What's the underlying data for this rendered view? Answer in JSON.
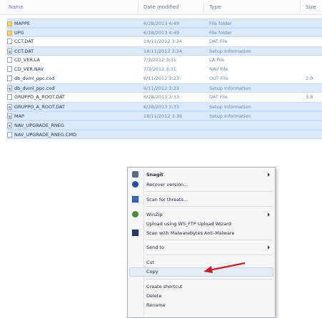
{
  "columns": {
    "name": "Name",
    "date": "Date modified",
    "type": "Type",
    "size": "Size"
  },
  "files": [
    {
      "name": "MAPPE",
      "date": "6/28/2013 4:49",
      "type": "File folder",
      "size": "",
      "icon": "folder-icon",
      "selected": true
    },
    {
      "name": "UPG",
      "date": "6/28/2013 4:49",
      "type": "File folder",
      "size": "",
      "icon": "folder-icon",
      "selected": true
    },
    {
      "name": "CCT.DAT",
      "date": "18/11/2012 3:24",
      "type": "DAT File",
      "size": "",
      "icon": "document-icon",
      "selected": false
    },
    {
      "name": "CCT.DAT",
      "date": "18/11/2012 3:24",
      "type": "Setup Information",
      "size": "",
      "icon": "setup-file-icon",
      "selected": true
    },
    {
      "name": "CD_VER.LA",
      "date": "7/3/2012 3:31",
      "type": "LA File",
      "size": "",
      "icon": "document-icon",
      "selected": false
    },
    {
      "name": "CD_VER.NAV",
      "date": "7/3/2012 3:31",
      "type": "NAV File",
      "size": "",
      "icon": "document-icon",
      "selected": false
    },
    {
      "name": "db_dvml_ppc.cod",
      "date": "6/11/2012 3:23",
      "type": "OUT File",
      "size": "2,0",
      "icon": "document-icon",
      "selected": false
    },
    {
      "name": "db_dvml_ppc.cod",
      "date": "6/11/2012 3:23",
      "type": "Setup Information",
      "size": "",
      "icon": "setup-file-icon",
      "selected": true
    },
    {
      "name": "GRUPPO_A_ROOT.DAT",
      "date": "6/28/2013 3:33",
      "type": "DAT File",
      "size": "3,8",
      "icon": "document-icon",
      "selected": false
    },
    {
      "name": "GRUPPO_A_ROOT.DAT",
      "date": "6/28/2013 3:33",
      "type": "Setup Information",
      "size": "",
      "icon": "setup-file-icon",
      "selected": true
    },
    {
      "name": "MAP",
      "date": "18/11/2012 3:36",
      "type": "Setup Information",
      "size": "",
      "icon": "setup-file-icon",
      "selected": true
    },
    {
      "name": "NAV_UPGRADE_RNEG",
      "date": "",
      "type": "",
      "size": "",
      "icon": "setup-file-icon",
      "selected": true
    },
    {
      "name": "NAV_UPGRADE_RNEG.CMD",
      "date": "",
      "type": "",
      "size": "",
      "icon": "document-icon",
      "selected": true
    }
  ],
  "context_menu": {
    "items": [
      {
        "label": "Snagit",
        "bold": true,
        "submenu": true,
        "icon": "snagit-icon"
      },
      {
        "label": "Recover version...",
        "icon": "recover-icon"
      },
      {
        "separator": true
      },
      {
        "label": "Scan for threats...",
        "icon": "scan-icon"
      },
      {
        "separator": true
      },
      {
        "label": "WinZip",
        "submenu": true,
        "icon": "winzip-icon"
      },
      {
        "label": "Upload using WS_FTP Upload Wizard"
      },
      {
        "label": "Scan with Malwarebytes Anti-Malware",
        "icon": "malwarebytes-icon"
      },
      {
        "separator": true
      },
      {
        "label": "Send to",
        "submenu": true
      },
      {
        "separator": true
      },
      {
        "label": "Cut"
      },
      {
        "label": "Copy",
        "highlighted": true
      },
      {
        "separator": true
      },
      {
        "label": "Create shortcut"
      },
      {
        "label": "Delete"
      },
      {
        "label": "Rename"
      }
    ]
  },
  "colors": {
    "selection": "#dbe9fa",
    "menu_bg": "#f5f6f8",
    "arrow": "#c8202a"
  }
}
